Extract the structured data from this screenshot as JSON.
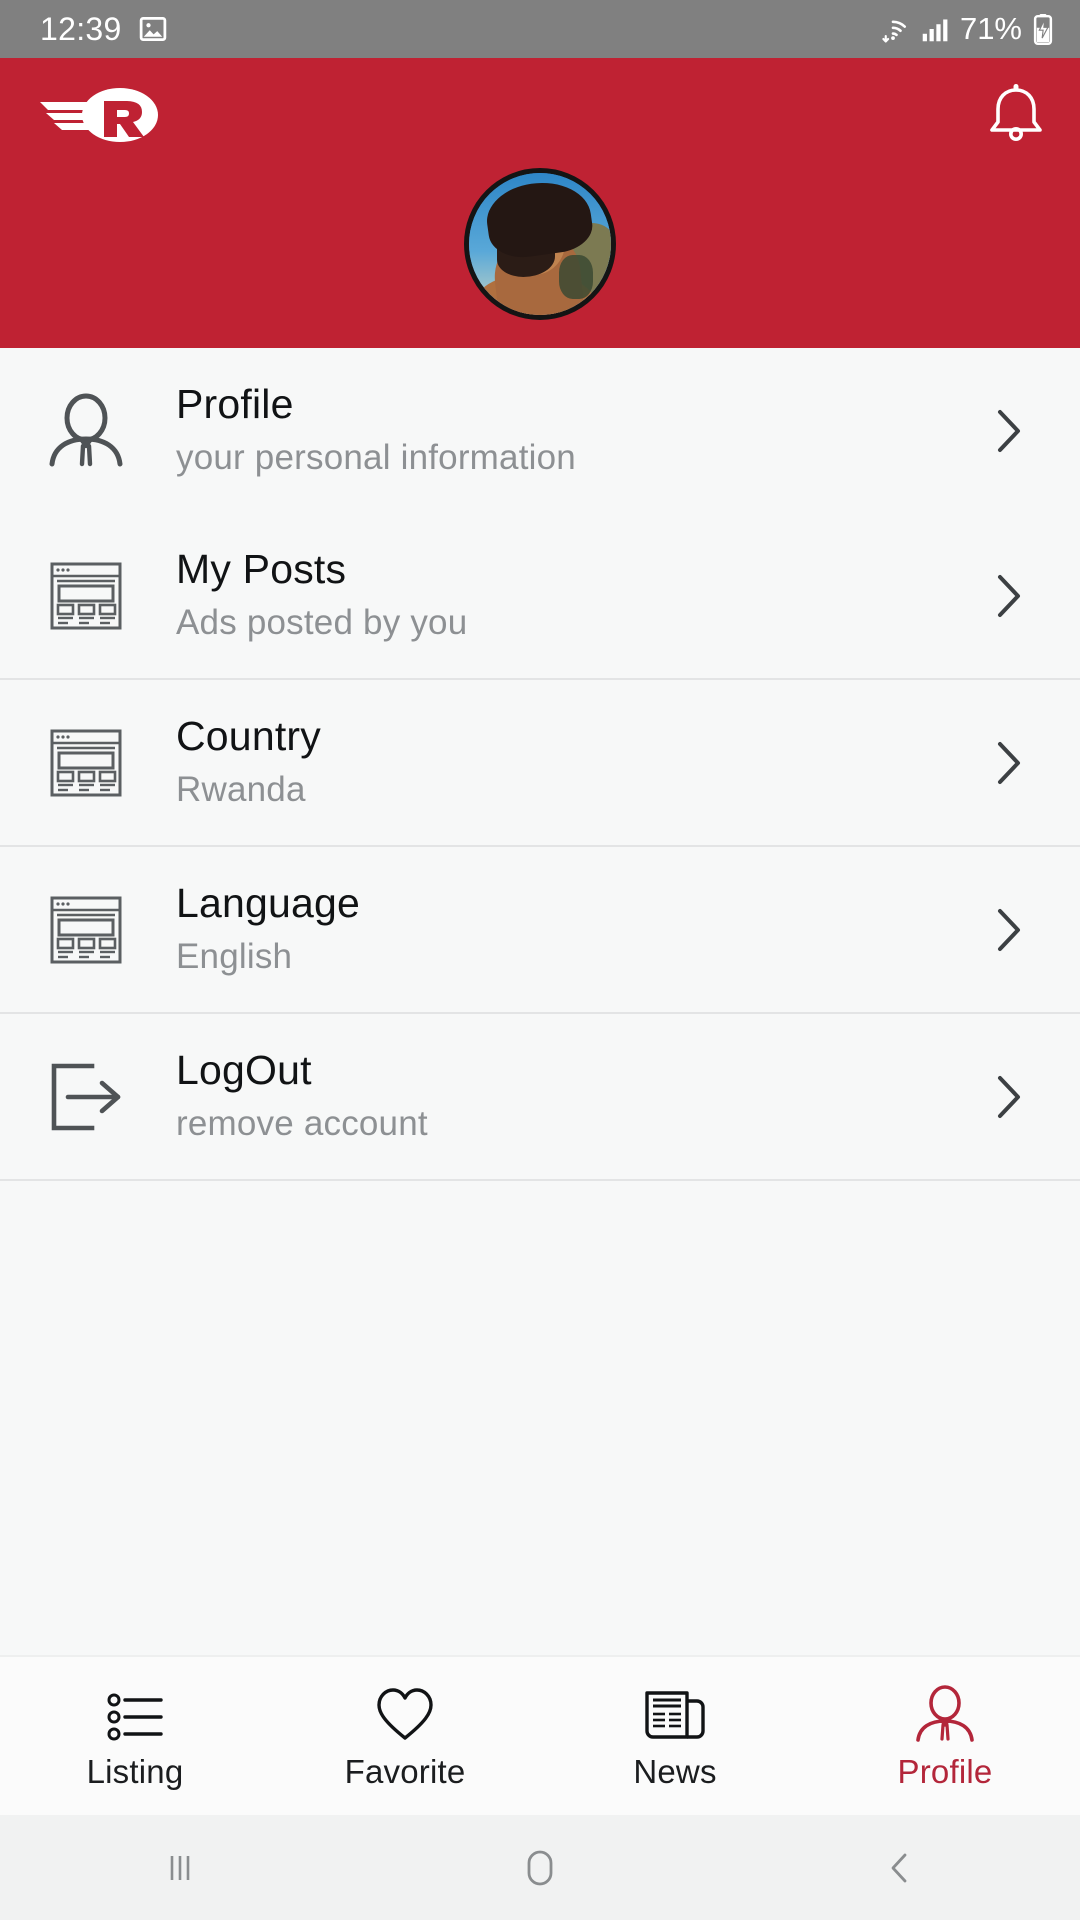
{
  "status_bar": {
    "time": "12:39",
    "battery_percent": "71%",
    "icons": [
      "image-icon",
      "wifi-icon",
      "signal-icon",
      "battery-charging-icon"
    ]
  },
  "header": {
    "logo_name": "winged-r-logo",
    "notification_icon": "bell-icon",
    "avatar_name": "user-avatar",
    "background_color": "#bf2233"
  },
  "menu": {
    "items": [
      {
        "title": "Profile",
        "subtitle": "your personal information",
        "icon": "person-icon",
        "chevron": "chevron-right-icon"
      },
      {
        "title": "My Posts",
        "subtitle": "Ads posted by you",
        "icon": "webpage-icon",
        "chevron": "chevron-right-icon"
      },
      {
        "title": "Country",
        "subtitle": "Rwanda",
        "icon": "webpage-icon",
        "chevron": "chevron-right-icon"
      },
      {
        "title": "Language",
        "subtitle": "English",
        "icon": "webpage-icon",
        "chevron": "chevron-right-icon"
      },
      {
        "title": "LogOut",
        "subtitle": "remove account",
        "icon": "logout-icon",
        "chevron": "chevron-right-icon"
      }
    ]
  },
  "bottom_nav": {
    "active_color": "#b3263a",
    "tabs": [
      {
        "label": "Listing",
        "icon": "list-icon",
        "active": false
      },
      {
        "label": "Favorite",
        "icon": "heart-icon",
        "active": false
      },
      {
        "label": "News",
        "icon": "newspaper-icon",
        "active": false
      },
      {
        "label": "Profile",
        "icon": "person-icon",
        "active": true
      }
    ]
  },
  "system_nav": {
    "buttons": [
      "recents-icon",
      "home-icon",
      "back-icon"
    ]
  }
}
